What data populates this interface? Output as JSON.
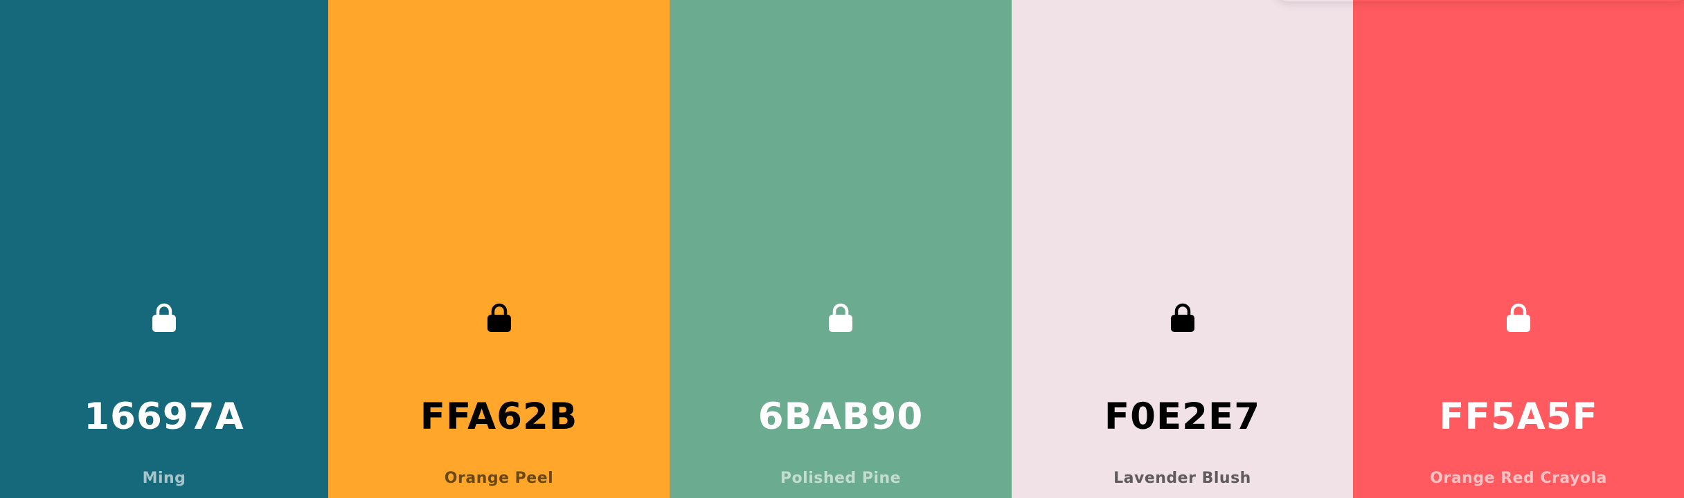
{
  "palette": {
    "swatches": [
      {
        "hex": "16697A",
        "name": "Ming",
        "background": "#16697A",
        "hex_color": "#FFFFFF",
        "name_color": "#A7C6CC",
        "lock_color": "#FFFFFF",
        "icon": "lock-icon"
      },
      {
        "hex": "FFA62B",
        "name": "Orange Peel",
        "background": "#FFA62B",
        "hex_color": "#000000",
        "name_color": "#6A4812",
        "lock_color": "#000000",
        "icon": "lock-icon"
      },
      {
        "hex": "6BAB90",
        "name": "Polished Pine",
        "background": "#6BAB90",
        "hex_color": "#FFFFFF",
        "name_color": "#C4DDD1",
        "lock_color": "#FFFFFF",
        "icon": "lock-icon"
      },
      {
        "hex": "F0E2E7",
        "name": "Lavender Blush",
        "background": "#F0E2E7",
        "hex_color": "#000000",
        "name_color": "#5F5A5C",
        "lock_color": "#000000",
        "icon": "lock-icon"
      },
      {
        "hex": "FF5A5F",
        "name": "Orange Red Crayola",
        "background": "#FF5A5F",
        "hex_color": "#FFFFFF",
        "name_color": "#FFC2C4",
        "lock_color": "#FFFFFF",
        "icon": "lock-icon"
      }
    ]
  }
}
